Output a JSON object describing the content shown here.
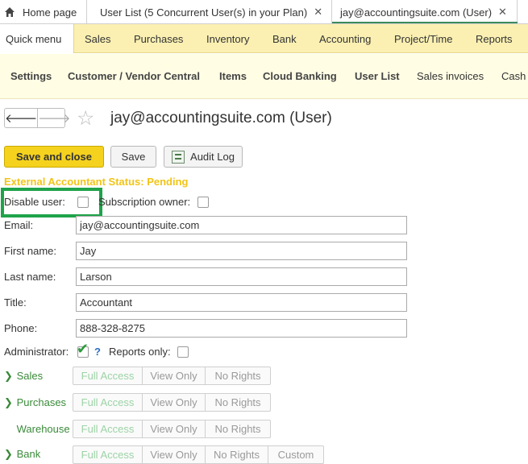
{
  "tabs": [
    {
      "label": "Home page",
      "icon": "home-icon"
    },
    {
      "label": "User List (5 Concurrent User(s) in your Plan)",
      "close": "✕"
    },
    {
      "label": "jay@accountingsuite.com (User)",
      "close": "✕"
    }
  ],
  "main_menu": [
    "Quick menu",
    "Sales",
    "Purchases",
    "Inventory",
    "Bank",
    "Accounting",
    "Project/Time",
    "Reports"
  ],
  "section_bar": [
    "Settings",
    "Customer / Vendor Central",
    "Items",
    "Cloud Banking",
    "User List",
    "Sales invoices",
    "Cash"
  ],
  "nav": {
    "back": "🡐",
    "forward": "🡒"
  },
  "page_title": "jay@accountingsuite.com (User)",
  "buttons": {
    "save_close": "Save and close",
    "save": "Save",
    "audit_log": "Audit Log"
  },
  "status": "External Accountant Status: Pending",
  "labels": {
    "disable_user": "Disable user:",
    "subscription_owner": "Subscription owner:",
    "email": "Email:",
    "first_name": "First name:",
    "last_name": "Last name:",
    "title": "Title:",
    "phone": "Phone:",
    "administrator": "Administrator:",
    "reports_only": "Reports only:",
    "help": "?"
  },
  "fields": {
    "email": "jay@accountingsuite.com",
    "first_name": "Jay",
    "last_name": "Larson",
    "title": "Accountant",
    "phone": "888-328-8275"
  },
  "permissions": [
    {
      "name": "Sales",
      "chevron": "❯",
      "options": [
        "Full Access",
        "View Only",
        "No Rights"
      ]
    },
    {
      "name": "Purchases",
      "chevron": "❯",
      "options": [
        "Full Access",
        "View Only",
        "No Rights"
      ]
    },
    {
      "name": "Warehouse",
      "chevron": "",
      "options": [
        "Full Access",
        "View Only",
        "No Rights"
      ]
    },
    {
      "name": "Bank",
      "chevron": "❯",
      "options": [
        "Full Access",
        "View Only",
        "No Rights",
        "Custom"
      ]
    }
  ],
  "colors": {
    "accent_yellow": "#f5d21e",
    "status_yellow": "#f2c417",
    "highlight_green": "#1fa34a",
    "menu_bg": "#fbf0b2"
  }
}
